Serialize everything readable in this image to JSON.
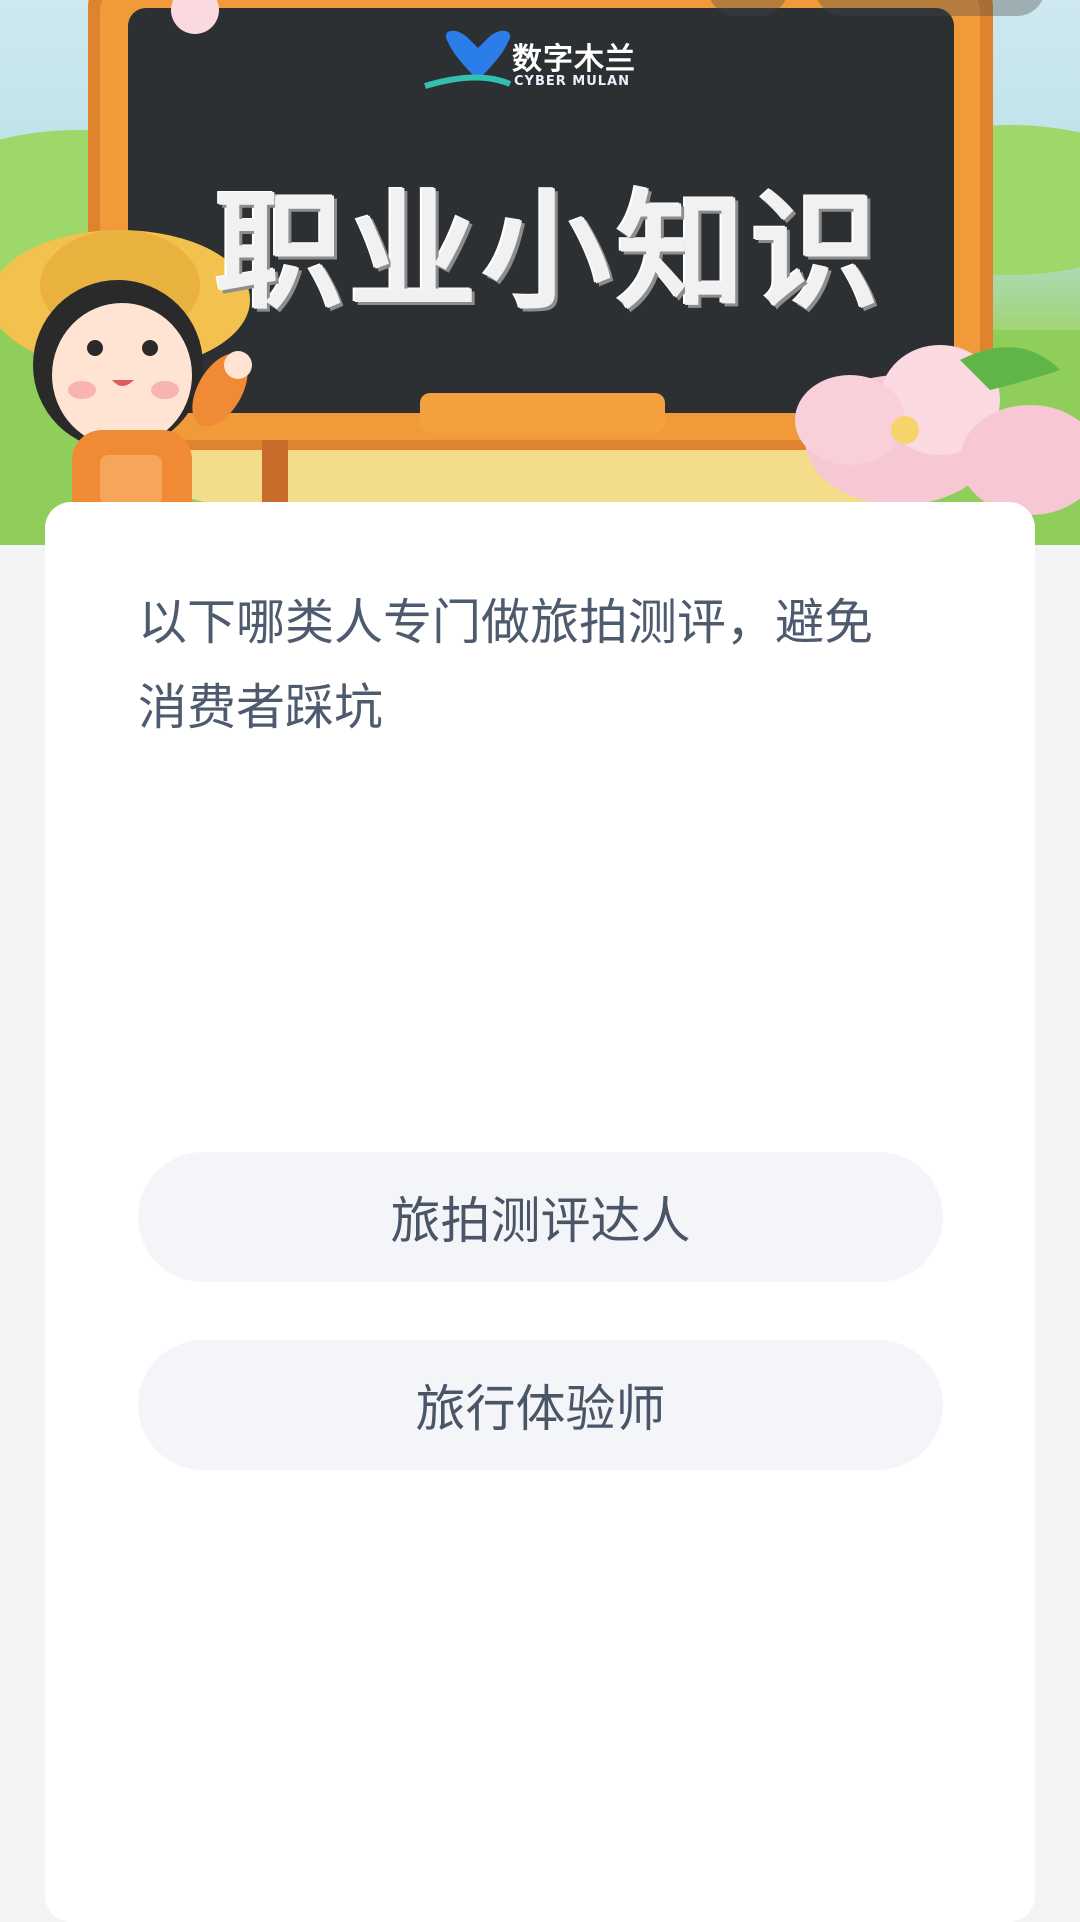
{
  "hero": {
    "brand_name": "数字木兰",
    "brand_subtitle": "CYBER MULAN",
    "board_title": "职业小知识"
  },
  "quiz": {
    "question": "以下哪类人专门做旅拍测评，避免消费者踩坑",
    "options": [
      {
        "label": "旅拍测评达人"
      },
      {
        "label": "旅行体验师"
      }
    ]
  },
  "colors": {
    "board_frame": "#e0832e",
    "chalkboard": "#2c3033",
    "question_text": "#4e5a6e",
    "option_bg": "#f4f5f8",
    "logo_heart": "#2b7de9"
  }
}
